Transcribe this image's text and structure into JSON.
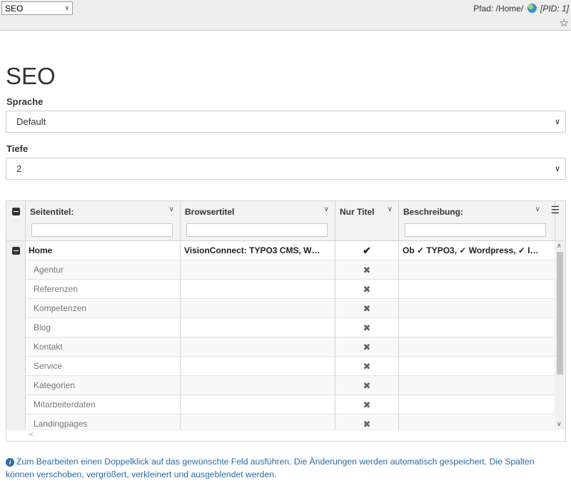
{
  "topbar": {
    "module_value": "SEO",
    "path_label": "Pfad: /Home/",
    "pid_label": "[PID: 1]"
  },
  "page_title": "SEO",
  "language": {
    "label": "Sprache",
    "value": "Default"
  },
  "depth": {
    "label": "Tiefe",
    "value": "2"
  },
  "grid": {
    "columns": [
      "Seitentitel:",
      "Browsertitel",
      "Nur Titel",
      "Beschreibung:"
    ],
    "rows": [
      {
        "title": "Home",
        "browsertitle": "VisionConnect: TYPO3 CMS, W…",
        "nur_titel": "✔",
        "description": "Ob ✓ TYPO3, ✓ Wordpress, ✓ I…"
      },
      {
        "title": "Agentur",
        "browsertitle": "",
        "nur_titel": "✖",
        "description": ""
      },
      {
        "title": "Referenzen",
        "browsertitle": "",
        "nur_titel": "✖",
        "description": ""
      },
      {
        "title": "Kompetenzen",
        "browsertitle": "",
        "nur_titel": "✖",
        "description": ""
      },
      {
        "title": "Blog",
        "browsertitle": "",
        "nur_titel": "✖",
        "description": ""
      },
      {
        "title": "Kontakt",
        "browsertitle": "",
        "nur_titel": "✖",
        "description": ""
      },
      {
        "title": "Service",
        "browsertitle": "",
        "nur_titel": "✖",
        "description": ""
      },
      {
        "title": "Kategorien",
        "browsertitle": "",
        "nur_titel": "✖",
        "description": ""
      },
      {
        "title": "Mitarbeiterdaten",
        "browsertitle": "",
        "nur_titel": "✖",
        "description": ""
      },
      {
        "title": "Landingpages",
        "browsertitle": "",
        "nur_titel": "✖",
        "description": ""
      }
    ]
  },
  "info_note": "Zum Bearbeiten einen Doppelklick auf das gewünschte Feld ausführen. Die Änderungen werden automatisch gespeichert. Die Spalten können verschoben, vergrößert, verkleinert und ausgeblendet werden.",
  "colors": {
    "accent_text": "#2a6aa6",
    "header_bg": "#f3f3f3",
    "topbar_bg": "#eeeeee"
  }
}
